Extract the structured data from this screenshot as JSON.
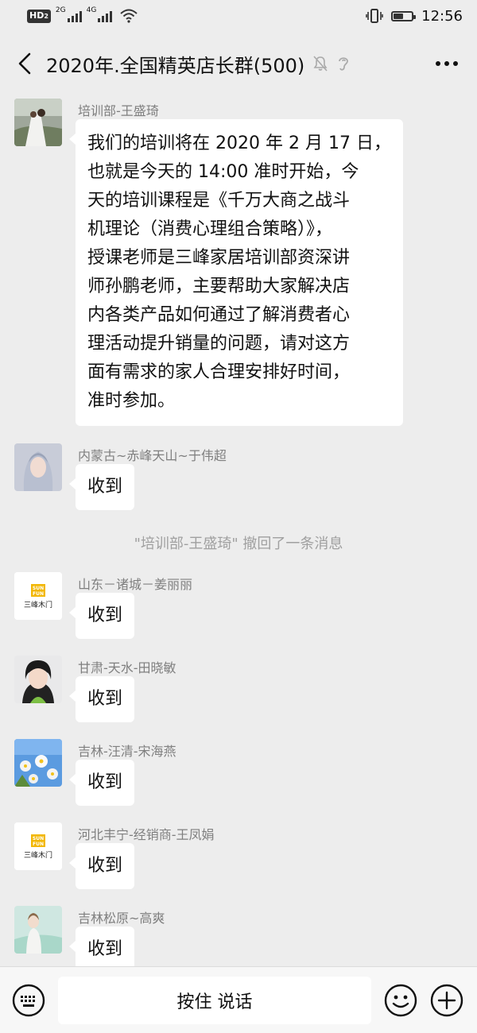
{
  "status_bar": {
    "hd_label": "HD",
    "hd_sub": "2",
    "net1": "2G",
    "net2": "4G",
    "time": "12:56",
    "battery_level": 0.55
  },
  "header": {
    "title": "2020年.全国精英店长群(500)"
  },
  "messages": [
    {
      "sender": "培训部-王盛琦",
      "lines": [
        "我们的培训将在 2020 年 2 月 17 日，",
        "也就是今天的 14:00 准时开始，今",
        "天的培训课程是《千万大商之战斗",
        "机理论（消费心理组合策略）》，",
        "授课老师是三峰家居培训部资深讲",
        "师孙鹏老师，主要帮助大家解决店",
        "内各类产品如何通过了解消费者心",
        "理活动提升销量的问题，请对这方",
        "面有需求的家人合理安排好时间，",
        "准时参加。"
      ]
    },
    {
      "sender": "内蒙古~赤峰天山~于伟超",
      "text": "收到"
    },
    {
      "sender": "山东－诸城－姜丽丽",
      "text": "收到"
    },
    {
      "sender": "甘肃-天水-田晓敏",
      "text": "收到"
    },
    {
      "sender": "吉林-汪清-宋海燕",
      "text": "收到"
    },
    {
      "sender": "河北丰宁-经销商-王凤娟",
      "text": "收到"
    },
    {
      "sender": "吉林松原~高爽",
      "text": "收到"
    }
  ],
  "system_note": "\"培训部-王盛琦\" 撤回了一条消息",
  "logo": {
    "top": "SUN",
    "mid": "FUN",
    "bottom": "三峰木门"
  },
  "input_bar": {
    "hold_to_talk": "按住 说话"
  }
}
